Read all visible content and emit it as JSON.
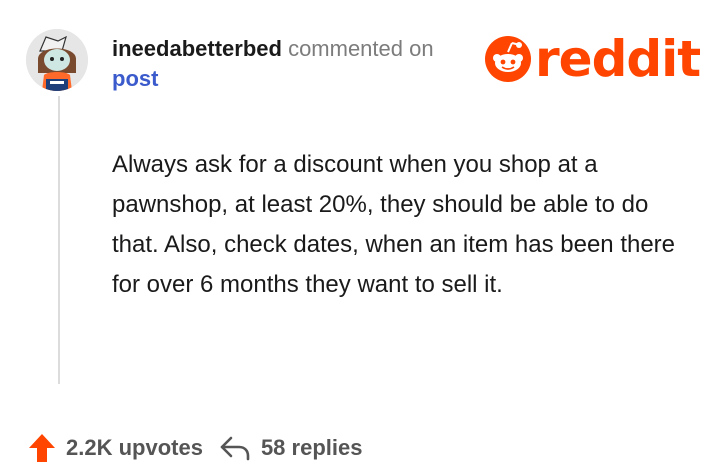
{
  "comment": {
    "username": "ineedabetterbed",
    "action": "commented on",
    "target_label": "post",
    "body": "Always ask for a discount when you shop at a pawnshop, at least 20%, they should be able to do that. Also, check dates, when an item has been there for over 6 months they want to sell it."
  },
  "brand": {
    "logo_text": "reddit",
    "color": "#ff4500"
  },
  "footer": {
    "upvotes": "2.2K upvotes",
    "replies": "58 replies",
    "upvote_icon": "upvote-arrow-icon",
    "reply_icon": "reply-arrow-icon"
  },
  "colors": {
    "link": "#3b5bcc",
    "upvote": "#ff4500"
  }
}
